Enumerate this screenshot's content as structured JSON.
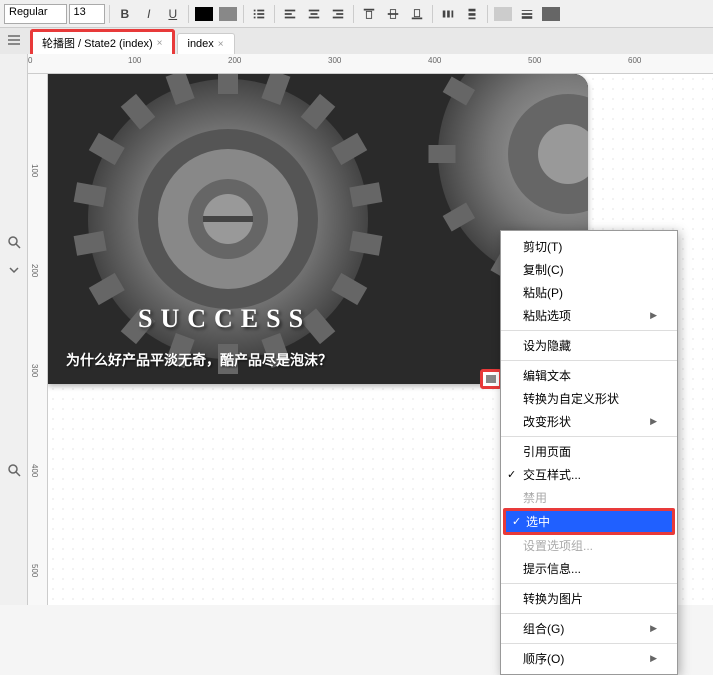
{
  "toolbar": {
    "font_weight": "Regular",
    "font_size": "13",
    "bold": "B",
    "italic": "I",
    "underline": "U"
  },
  "tabs": {
    "active_label": "轮播图 / State2 (index)",
    "second_label": "index"
  },
  "ruler": {
    "marks": [
      "0",
      "100",
      "200",
      "300",
      "400",
      "500",
      "600"
    ],
    "vmarks": [
      "100",
      "200",
      "300",
      "400",
      "500"
    ]
  },
  "image": {
    "success": "SUCCESS",
    "caption": "为什么好产品平淡无奇，酷产品尽是泡沫？"
  },
  "menu": {
    "items": [
      {
        "label": "剪切(T)",
        "type": "item"
      },
      {
        "label": "复制(C)",
        "type": "item"
      },
      {
        "label": "粘贴(P)",
        "type": "item"
      },
      {
        "label": "粘贴选项",
        "type": "submenu"
      },
      {
        "type": "sep"
      },
      {
        "label": "设为隐藏",
        "type": "item"
      },
      {
        "type": "sep"
      },
      {
        "label": "编辑文本",
        "type": "item"
      },
      {
        "label": "转换为自定义形状",
        "type": "item"
      },
      {
        "label": "改变形状",
        "type": "submenu"
      },
      {
        "type": "sep"
      },
      {
        "label": "引用页面",
        "type": "item"
      },
      {
        "label": "交互样式...",
        "type": "item",
        "check": true
      },
      {
        "label": "禁用",
        "type": "item",
        "disabled": true
      },
      {
        "label": "选中",
        "type": "item",
        "check": true,
        "selected": true,
        "highlighted": true
      },
      {
        "label": "设置选项组...",
        "type": "item",
        "disabled": true
      },
      {
        "label": "提示信息...",
        "type": "item"
      },
      {
        "type": "sep"
      },
      {
        "label": "转换为图片",
        "type": "item"
      },
      {
        "type": "sep"
      },
      {
        "label": "组合(G)",
        "type": "submenu"
      },
      {
        "type": "sep"
      },
      {
        "label": "顺序(O)",
        "type": "submenu"
      }
    ]
  }
}
